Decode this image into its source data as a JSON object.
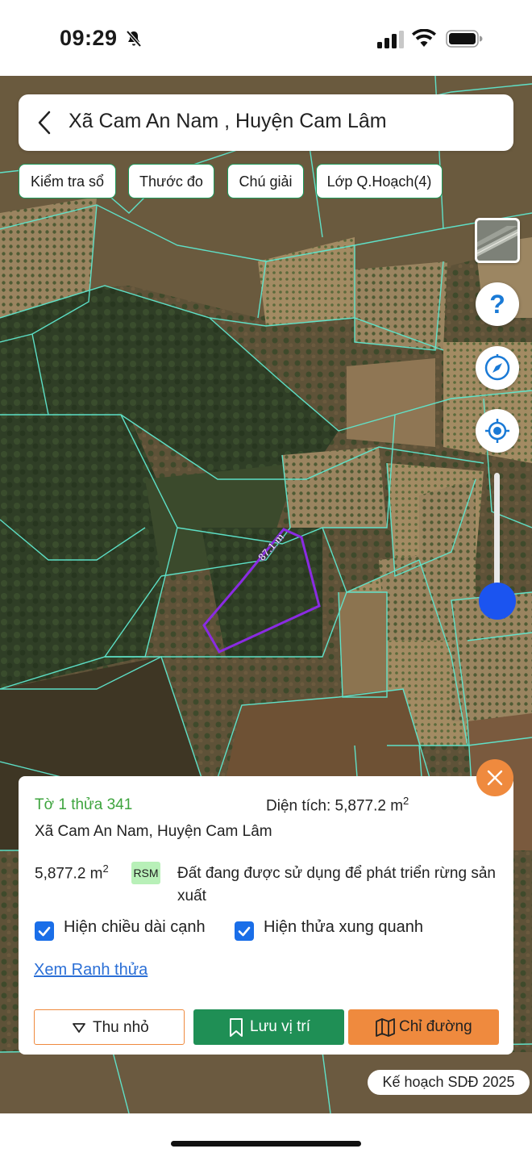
{
  "status_bar": {
    "time": "09:29"
  },
  "header": {
    "title": "Xã Cam An Nam , Huyện Cam Lâm"
  },
  "chips": [
    {
      "label": "Kiểm tra sổ"
    },
    {
      "label": "Thước đo"
    },
    {
      "label": "Chú giải"
    },
    {
      "label": "Lớp Q.Hoạch(4)"
    }
  ],
  "map": {
    "segment_label": "87.1 m",
    "plan_badge": "Kế hoạch SDĐ 2025",
    "colors": {
      "parcel_lines": "#5fe8cf",
      "selected_parcel": "#8a2be2",
      "slider": "#1b54f0"
    }
  },
  "panel": {
    "parcel_id": "Tờ 1 thửa 341",
    "area_label": "Diện tích: 5,877.2 m",
    "area_sup": "2",
    "location": "Xã Cam An Nam, Huyện Cam Lâm",
    "area_value": "5,877.2 m",
    "area_value_sup": "2",
    "land_code": "RSM",
    "land_desc": "Đất đang được sử dụng để phát triển rừng sản xuất",
    "checkbox_edges": {
      "label": "Hiện chiều dài cạnh",
      "checked": true
    },
    "checkbox_neighbors": {
      "label": "Hiện thửa xung quanh",
      "checked": true
    },
    "link": "Xem Ranh thửa",
    "buttons": {
      "collapse": "Thu nhỏ",
      "save": "Lưu vị trí",
      "route": "Chỉ đường"
    }
  },
  "colors": {
    "accent_green": "#1f8f55",
    "accent_orange": "#ef8a3e",
    "link_blue": "#2b6fd6",
    "checkbox_blue": "#1a6ee8"
  }
}
